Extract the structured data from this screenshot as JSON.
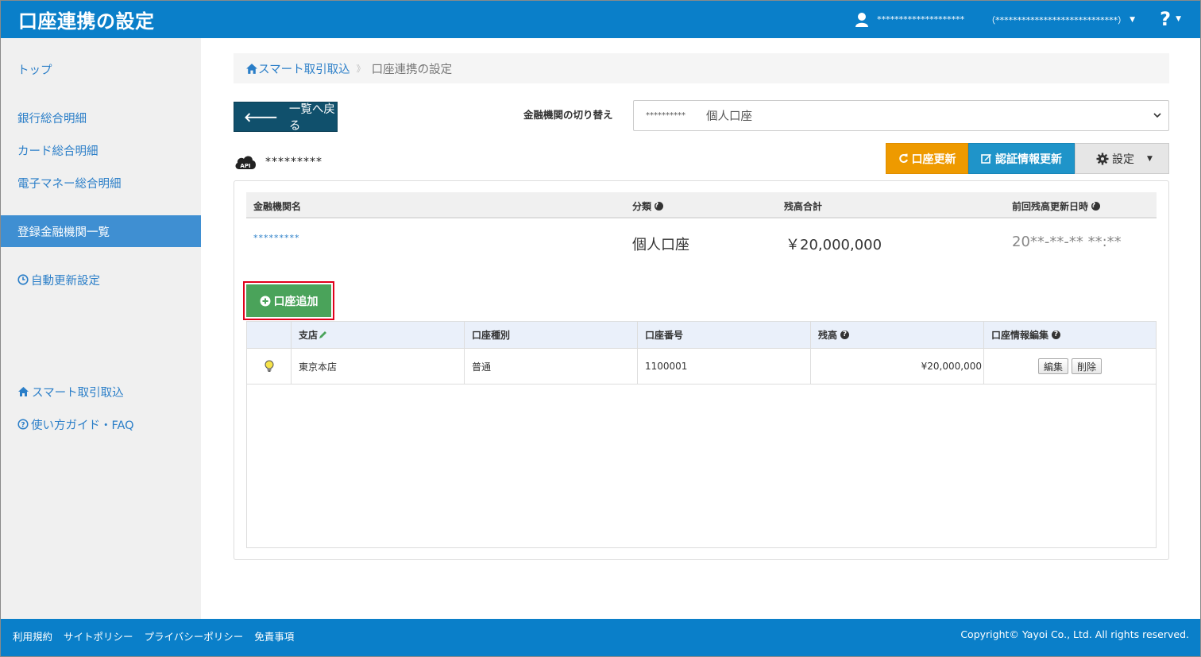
{
  "header": {
    "title": "口座連携の設定",
    "user_name": "********************",
    "user_org": "（****************************）",
    "help": "?"
  },
  "sidebar": {
    "items": [
      {
        "label": "トップ"
      },
      {
        "label": "銀行総合明細"
      },
      {
        "label": "カード総合明細"
      },
      {
        "label": "電子マネー総合明細"
      },
      {
        "label": "登録金融機関一覧"
      },
      {
        "label": "自動更新設定"
      },
      {
        "label": "スマート取引取込"
      },
      {
        "label": "使い方ガイド・FAQ"
      }
    ]
  },
  "breadcrumb": {
    "home": "スマート取引取込",
    "current": "口座連携の設定"
  },
  "toolbar": {
    "back_label": "一覧へ戻る",
    "switch_label": "金融機関の切り替え",
    "switch_value_mask": "**********",
    "switch_value": "個人口座"
  },
  "bank": {
    "api_badge": "API",
    "name": "*********",
    "refresh_label": "口座更新",
    "auth_label": "認証情報更新",
    "settings_label": "設定"
  },
  "summary": {
    "headers": {
      "name": "金融機関名",
      "category": "分類",
      "total": "残高合計",
      "updated": "前回残高更新日時"
    },
    "row": {
      "name": "*********",
      "category": "個人口座",
      "total": "￥20,000,000",
      "updated": "20**-**-**  **:**"
    }
  },
  "accounts": {
    "add_label": "口座追加",
    "headers": {
      "branch": "支店",
      "type": "口座種別",
      "number": "口座番号",
      "balance": "残高",
      "edit": "口座情報編集"
    },
    "rows": [
      {
        "branch": "東京本店",
        "type": "普通",
        "number": "1100001",
        "balance": "¥20,000,000",
        "edit_label": "編集",
        "delete_label": "削除"
      }
    ]
  },
  "footer": {
    "links": [
      "利用規約",
      "サイトポリシー",
      "プライバシーポリシー",
      "免責事項"
    ],
    "copyright": "Copyright© Yayoi Co., Ltd. All rights reserved."
  },
  "colors": {
    "brand_blue": "#0a7fc9",
    "active_nav": "#3f8fd2",
    "back_button": "#10506c",
    "refresh_button": "#ee9a00",
    "auth_button": "#1f94c9",
    "add_button": "#4aa35a",
    "highlight_border": "#e0001a"
  }
}
